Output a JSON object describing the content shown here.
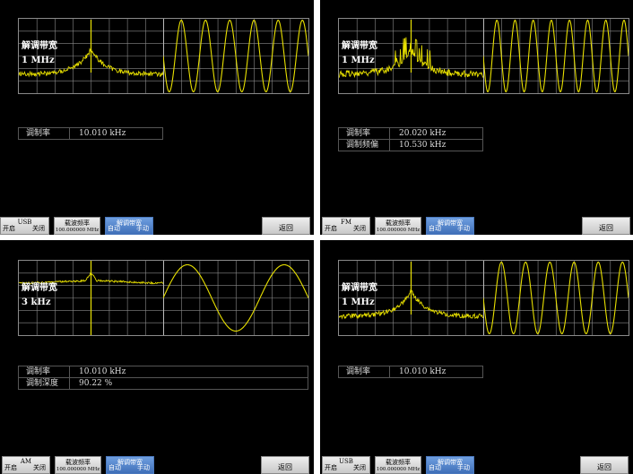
{
  "panels": [
    {
      "demod_title": "解调带宽",
      "demod_value": "1 MHz",
      "readouts": [
        {
          "label": "调制率",
          "value": "10.010 kHz"
        }
      ],
      "softkeys": {
        "mode": {
          "title": "USB",
          "left": "开启",
          "right": "关闭"
        },
        "carrier": {
          "title": "载波频率",
          "value": "100.000000 MHz"
        },
        "demod": {
          "title": "解调带宽",
          "left": "自动",
          "right": "手动"
        },
        "back": "返回"
      }
    },
    {
      "demod_title": "解调带宽",
      "demod_value": "1 MHz",
      "readouts": [
        {
          "label": "调制率",
          "value": "20.020 kHz"
        },
        {
          "label": "调制频偏",
          "value": "10.530 kHz"
        }
      ],
      "softkeys": {
        "mode": {
          "title": "FM",
          "left": "开启",
          "right": "关闭"
        },
        "carrier": {
          "title": "载波频率",
          "value": "100.000000 MHz"
        },
        "demod": {
          "title": "解调带宽",
          "left": "自动",
          "right": "手动"
        },
        "back": "返回"
      }
    },
    {
      "demod_title": "解调带宽",
      "demod_value": "3 kHz",
      "readouts": [
        {
          "label": "调制率",
          "value": "10.010 kHz"
        },
        {
          "label": "调制深度",
          "value": "90.22 %"
        }
      ],
      "softkeys": {
        "mode": {
          "title": "AM",
          "left": "开启",
          "right": "关闭"
        },
        "carrier": {
          "title": "载波频率",
          "value": "100.000000 MHz"
        },
        "demod": {
          "title": "解调带宽",
          "left": "自动",
          "right": "手动"
        },
        "back": "返回"
      }
    },
    {
      "demod_title": "解调带宽",
      "demod_value": "1 MHz",
      "readouts": [
        {
          "label": "调制率",
          "value": "10.010 kHz"
        }
      ],
      "softkeys": {
        "mode": {
          "title": "USB",
          "left": "开启",
          "right": "关闭"
        },
        "carrier": {
          "title": "载波频率",
          "value": "100.000000 MHz"
        },
        "demod": {
          "title": "解调带宽",
          "left": "自动",
          "right": "手动"
        },
        "back": "返回"
      }
    }
  ],
  "colors": {
    "trace": "#e8e000",
    "grid": "#8a8a8a",
    "active_key": "#4a7fcc"
  }
}
